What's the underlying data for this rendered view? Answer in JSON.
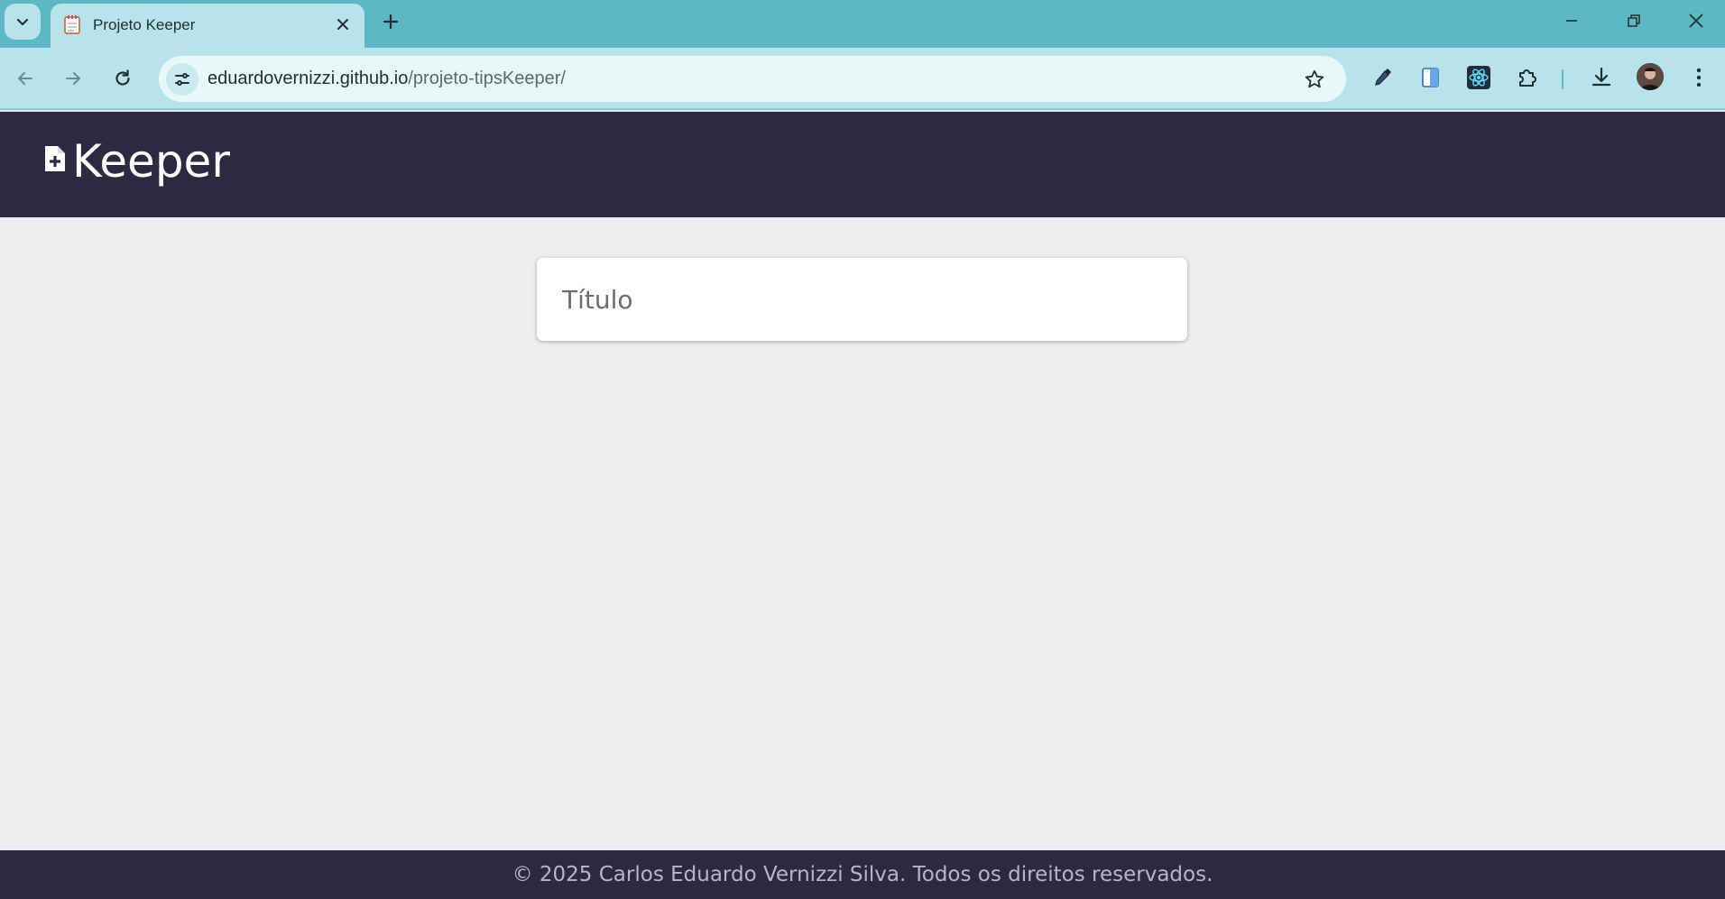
{
  "browser": {
    "tab": {
      "title": "Projeto Keeper",
      "favicon": "notepad-icon"
    },
    "address": {
      "domain": "eduardovernizzi.github.io",
      "path": "/projeto-tipsKeeper/"
    },
    "extensions": [
      "eyedropper-icon",
      "document-extension-icon",
      "react-devtools-icon",
      "puzzle-icon"
    ],
    "colors": {
      "frame": "#5db8c4",
      "toolbar": "#b9e3ea"
    }
  },
  "app": {
    "brand": {
      "name": "Keeper",
      "icon": "note-add-icon"
    },
    "form": {
      "title_placeholder": "Título"
    },
    "footer": {
      "text": "© 2025 Carlos Eduardo Vernizzi Silva. Todos os direitos reservados."
    },
    "colors": {
      "header": "#2c2a40",
      "background": "#eeeeee"
    }
  }
}
